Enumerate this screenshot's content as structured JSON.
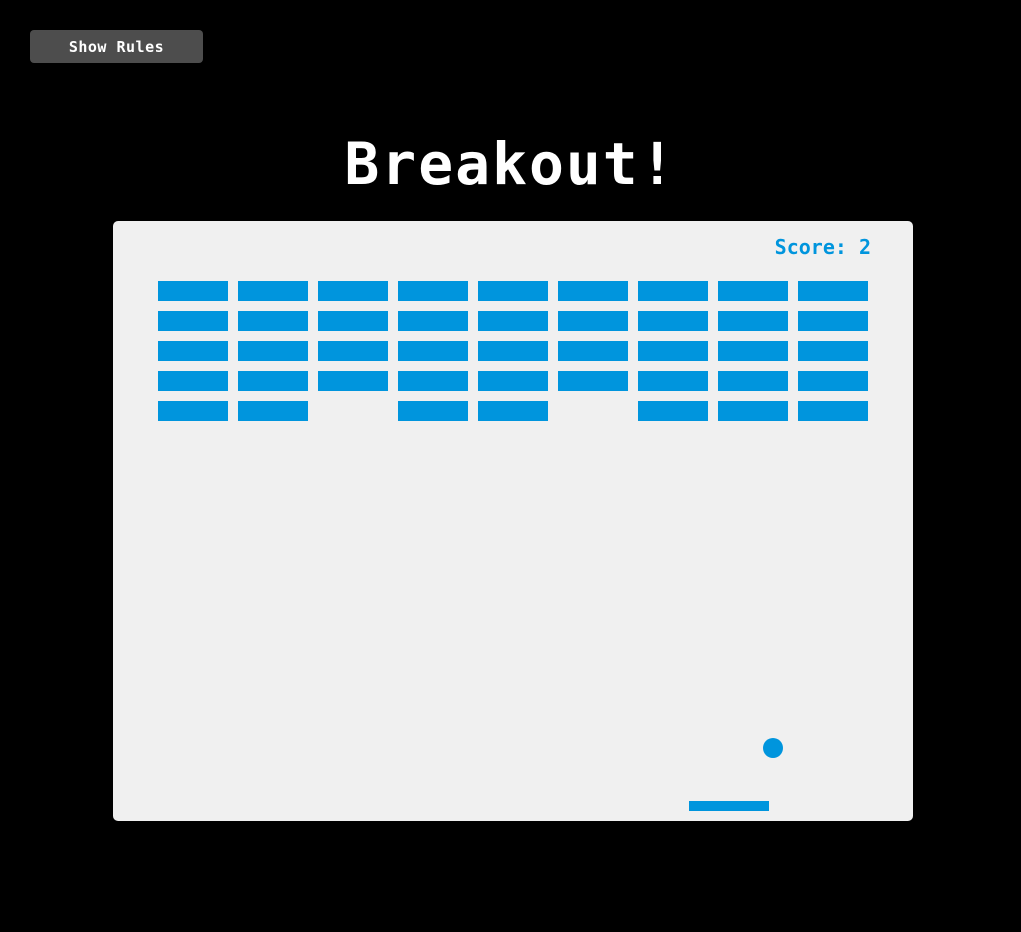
{
  "header": {
    "rules_button_label": "Show Rules",
    "title": "Breakout!"
  },
  "game": {
    "score_label": "Score: 2",
    "accent_color": "#0095dd",
    "canvas_color": "#f0f0f0",
    "background_color": "#000000",
    "brick_rows": 5,
    "brick_columns": 9,
    "broken_bricks": [
      [
        4,
        2
      ],
      [
        4,
        5
      ]
    ]
  }
}
